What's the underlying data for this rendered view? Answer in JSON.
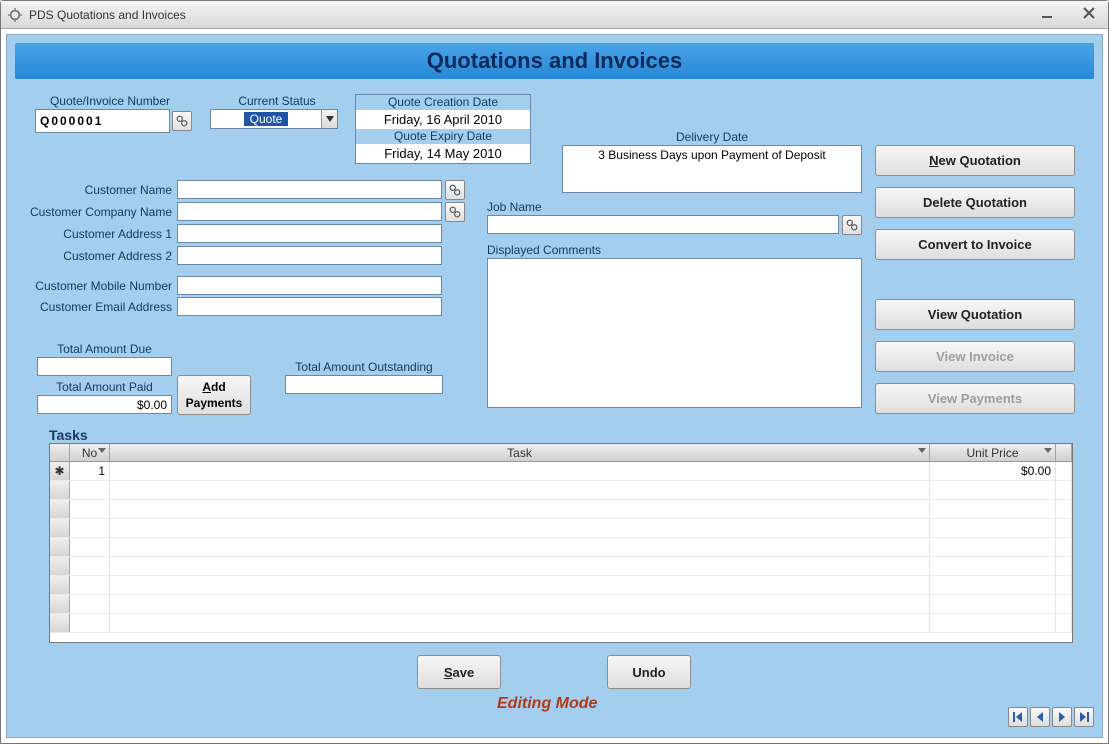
{
  "window": {
    "title": "PDS Quotations and Invoices"
  },
  "header": {
    "title": "Quotations and Invoices"
  },
  "labels": {
    "quote_number": "Quote/Invoice Number",
    "current_status": "Current Status",
    "quote_creation_date": "Quote Creation Date",
    "quote_expiry_date": "Quote Expiry Date",
    "delivery_date": "Delivery Date",
    "customer_name": "Customer Name",
    "customer_company": "Customer Company Name",
    "customer_addr1": "Customer Address 1",
    "customer_addr2": "Customer Address 2",
    "customer_mobile": "Customer Mobile Number",
    "customer_email": "Customer Email Address",
    "total_due": "Total Amount Due",
    "total_paid": "Total Amount Paid",
    "total_outstanding": "Total Amount Outstanding",
    "job_name": "Job Name",
    "displayed_comments": "Displayed Comments",
    "tasks": "Tasks"
  },
  "values": {
    "quote_number": "Q000001",
    "status_selected": "Quote",
    "creation_date": "Friday, 16 April 2010",
    "expiry_date": "Friday, 14 May 2010",
    "delivery_date_text": "3 Business Days upon Payment of Deposit",
    "customer_name": "",
    "customer_company": "",
    "customer_addr1": "",
    "customer_addr2": "",
    "customer_mobile": "",
    "customer_email": "",
    "job_name": "",
    "displayed_comments": "",
    "total_due": "",
    "total_paid": "$0.00",
    "total_outstanding": ""
  },
  "buttons": {
    "new_quotation": "New Quotation",
    "delete_quotation": "Delete Quotation",
    "convert_to_invoice": "Convert to Invoice",
    "view_quotation": "View Quotation",
    "view_invoice": "View Invoice",
    "view_payments": "View Payments",
    "add_payments": "Add Payments",
    "save": "Save",
    "undo": "Undo"
  },
  "grid": {
    "columns": {
      "no": "No",
      "task": "Task",
      "unit_price": "Unit Price"
    },
    "rows": [
      {
        "no": "1",
        "task": "",
        "unit_price": "$0.00"
      }
    ]
  },
  "status_mode": "Editing Mode"
}
